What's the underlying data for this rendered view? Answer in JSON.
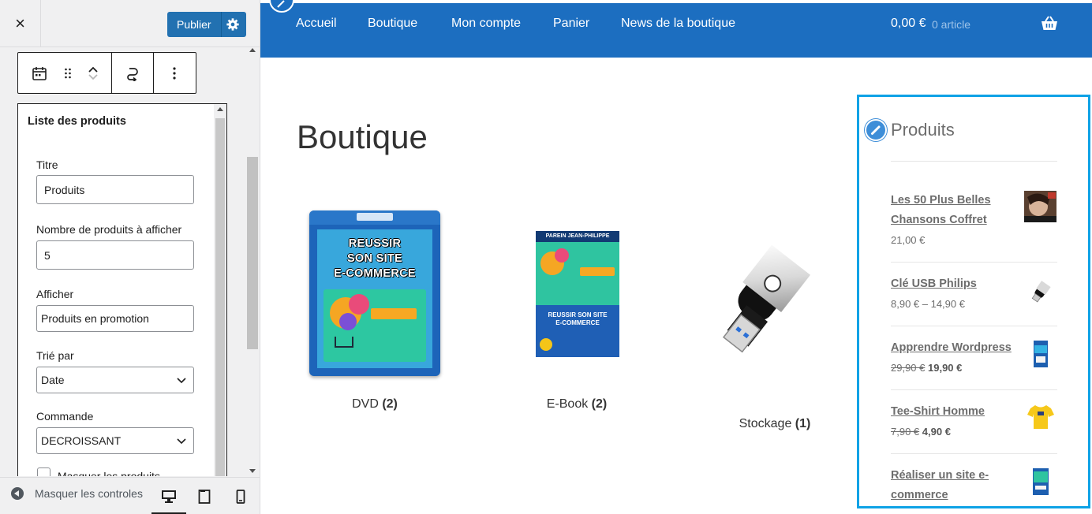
{
  "sidebar": {
    "close_label": "×",
    "publish_label": "Publier",
    "panel": {
      "title": "Liste des produits",
      "fields": {
        "title_label": "Titre",
        "title_value": "Produits",
        "count_label": "Nombre de produits à afficher",
        "count_value": "5",
        "show_label": "Afficher",
        "show_value": "Produits en promotion",
        "sort_label": "Trié par",
        "sort_value": "Date",
        "order_label": "Commande",
        "order_value": "DECROISSANT",
        "hide_checkbox_label": "Masquer les produits"
      }
    },
    "footer": {
      "hide_controls_label": "Masquer les controles"
    }
  },
  "preview": {
    "nav": {
      "items": [
        "Accueil",
        "Boutique",
        "Mon compte",
        "Panier",
        "News de la boutique"
      ],
      "cart_amount": "0,00 €",
      "cart_count": "0 article"
    },
    "page_title": "Boutique",
    "categories": [
      {
        "name": "DVD",
        "count": "(2)"
      },
      {
        "name": "E-Book",
        "count": "(2)"
      },
      {
        "name": "Stockage",
        "count": "(1)"
      }
    ],
    "dvd_cover_text": [
      "REUSSIR",
      "SON SITE",
      "E-COMMERCE"
    ],
    "ebook_cover": {
      "author": "PAREIN JEAN-PHILIPPE",
      "title_line1": "REUSSIR SON SITE",
      "title_line2": "E-COMMERCE"
    },
    "widget": {
      "title": "Produits",
      "products": [
        {
          "name_line1": "Les 50 Plus Belles",
          "name_line2": "Chansons Coffret",
          "price": "21,00 €"
        },
        {
          "name_line1": "Clé USB Philips",
          "name_line2": "",
          "price": "8,90 € – 14,90 €"
        },
        {
          "name_line1": "Apprendre Wordpress",
          "name_line2": "",
          "old_price": "29,90 €",
          "new_price": "19,90 €"
        },
        {
          "name_line1": "Tee-Shirt Homme",
          "name_line2": "",
          "old_price": "7,90 €",
          "new_price": "4,90 €"
        },
        {
          "name_line1": "Réaliser un site e-",
          "name_line2": "commerce"
        }
      ]
    }
  },
  "colors": {
    "nav_bg": "#1c6ec0",
    "publish_bg": "#2271b1",
    "widget_border": "#0ea2e6"
  }
}
